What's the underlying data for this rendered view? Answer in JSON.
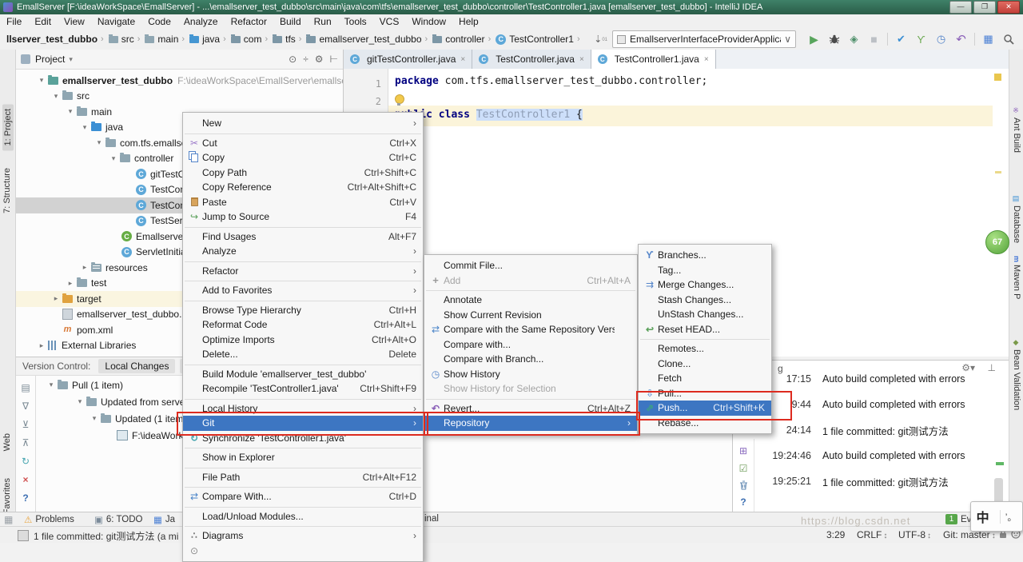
{
  "window": {
    "title": "EmallServer [F:\\ideaWorkSpace\\EmallServer] - ...\\emallserver_test_dubbo\\src\\main\\java\\com\\tfs\\emallserver_test_dubbo\\controller\\TestController1.java [emallserver_test_dubbo] - IntelliJ IDEA"
  },
  "menubar": {
    "items": [
      "File",
      "Edit",
      "View",
      "Navigate",
      "Code",
      "Analyze",
      "Refactor",
      "Build",
      "Run",
      "Tools",
      "VCS",
      "Window",
      "Help"
    ]
  },
  "navbar": {
    "breadcrumbs": [
      "llserver_test_dubbo",
      "src",
      "main",
      "java",
      "com",
      "tfs",
      "emallserver_test_dubbo",
      "controller",
      "TestController1"
    ],
    "run_config": "EmallserverInterfaceProviderApplication"
  },
  "stripes": {
    "left_top": [
      "1: Project",
      "7: Structure"
    ],
    "left_bottom": [
      "Web",
      "2: Favorites"
    ],
    "right": [
      "Ant Build",
      "Database",
      "Maven P",
      "Bean Validation"
    ],
    "notification_count": "67"
  },
  "project": {
    "title": "Project",
    "tree": [
      {
        "label": "emallserver_test_dubbo",
        "path": "F:\\ideaWorkSpace\\EmallServer\\emallserv"
      },
      {
        "label": "src"
      },
      {
        "label": "main"
      },
      {
        "label": "java"
      },
      {
        "label": "com.tfs.emallse"
      },
      {
        "label": "controller"
      },
      {
        "label": "gitTestC"
      },
      {
        "label": "TestCon"
      },
      {
        "label": "TestCon"
      },
      {
        "label": "TestSer"
      },
      {
        "label": "Emallserver"
      },
      {
        "label": "ServletInitia"
      },
      {
        "label": "resources"
      },
      {
        "label": "test"
      },
      {
        "label": "target"
      },
      {
        "label": "emallserver_test_dubbo.i"
      },
      {
        "label": "pom.xml"
      },
      {
        "label": "External Libraries"
      }
    ]
  },
  "editor": {
    "tabs": [
      "gitTestController.java",
      "TestController.java",
      "TestController1.java"
    ],
    "gutter": [
      "1",
      "2"
    ],
    "code": {
      "line1_kw": "package",
      "line1_rest": " com.tfs.emallserver_test_dubbo.controller;",
      "line3_kw": "public class ",
      "line3_name": "TestController1",
      "line3_brace": " {"
    }
  },
  "vcs": {
    "title": "Version Control:",
    "tabs": [
      "Local Changes",
      "Lo"
    ],
    "tree": [
      "Pull (1 item)",
      "Updated from serve",
      "Updated (1 item)",
      "F:\\ideaWorkS"
    ]
  },
  "event_log": {
    "header_tail": "g",
    "rows": [
      {
        "time": "17:15",
        "text": "Auto build completed with errors"
      },
      {
        "time": "9:44",
        "text": "Auto build completed with errors"
      },
      {
        "time": "24:14",
        "text": "1 file committed: git测试方法"
      },
      {
        "time": "19:24:46",
        "text": "Auto build completed with errors"
      },
      {
        "time": "19:25:21",
        "text": "1 file committed: git测试方法"
      }
    ]
  },
  "menus": {
    "context": {
      "items": [
        {
          "label": "New"
        },
        {
          "label": "Cut",
          "shortcut": "Ctrl+X"
        },
        {
          "label": "Copy",
          "shortcut": "Ctrl+C"
        },
        {
          "label": "Copy Path",
          "shortcut": "Ctrl+Shift+C"
        },
        {
          "label": "Copy Reference",
          "shortcut": "Ctrl+Alt+Shift+C"
        },
        {
          "label": "Paste",
          "shortcut": "Ctrl+V"
        },
        {
          "label": "Jump to Source",
          "shortcut": "F4"
        },
        {
          "label": "Find Usages",
          "shortcut": "Alt+F7"
        },
        {
          "label": "Analyze"
        },
        {
          "label": "Refactor"
        },
        {
          "label": "Add to Favorites"
        },
        {
          "label": "Browse Type Hierarchy",
          "shortcut": "Ctrl+H"
        },
        {
          "label": "Reformat Code",
          "shortcut": "Ctrl+Alt+L"
        },
        {
          "label": "Optimize Imports",
          "shortcut": "Ctrl+Alt+O"
        },
        {
          "label": "Delete...",
          "shortcut": "Delete"
        },
        {
          "label": "Build Module 'emallserver_test_dubbo'"
        },
        {
          "label": "Recompile 'TestController1.java'",
          "shortcut": "Ctrl+Shift+F9"
        },
        {
          "label": "Local History"
        },
        {
          "label": "Git"
        },
        {
          "label": "Synchronize 'TestController1.java'"
        },
        {
          "label": "Show in Explorer"
        },
        {
          "label": "File Path",
          "shortcut": "Ctrl+Alt+F12"
        },
        {
          "label": "Compare With...",
          "shortcut": "Ctrl+D"
        },
        {
          "label": "Load/Unload Modules..."
        },
        {
          "label": "Diagrams"
        }
      ]
    },
    "git": {
      "items": [
        {
          "label": "Commit File..."
        },
        {
          "label": "Add",
          "shortcut": "Ctrl+Alt+A"
        },
        {
          "label": "Annotate"
        },
        {
          "label": "Show Current Revision"
        },
        {
          "label": "Compare with the Same Repository Version"
        },
        {
          "label": "Compare with..."
        },
        {
          "label": "Compare with Branch..."
        },
        {
          "label": "Show History"
        },
        {
          "label": "Show History for Selection"
        },
        {
          "label": "Revert...",
          "shortcut": "Ctrl+Alt+Z"
        },
        {
          "label": "Repository"
        }
      ]
    },
    "repository": {
      "items": [
        {
          "label": "Branches..."
        },
        {
          "label": "Tag..."
        },
        {
          "label": "Merge Changes..."
        },
        {
          "label": "Stash Changes..."
        },
        {
          "label": "UnStash Changes..."
        },
        {
          "label": "Reset HEAD..."
        },
        {
          "label": "Remotes..."
        },
        {
          "label": "Clone..."
        },
        {
          "label": "Fetch"
        },
        {
          "label": "Pull..."
        },
        {
          "label": "Push...",
          "shortcut": "Ctrl+Shift+K"
        },
        {
          "label": "Rebase..."
        }
      ]
    }
  },
  "bottom_bar": {
    "problems": "Problems",
    "todo": "6: TODO",
    "java_tail": "Ja",
    "terminal_tail": "inal",
    "event_badge": "1",
    "event_log": "Eve"
  },
  "status_bar": {
    "message": "1 file committed: git测试方法 (a mi",
    "position": "3:29",
    "line_ending": "CRLF",
    "encoding": "UTF-8",
    "branch": "Git: master",
    "watermark": "https://blog.csdn.net"
  },
  "ime": {
    "lang": "中",
    "punct": "’。"
  }
}
